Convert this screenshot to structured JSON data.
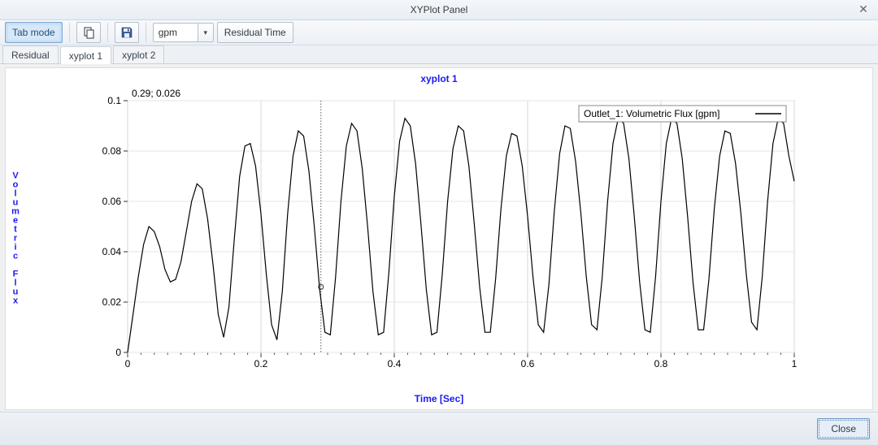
{
  "window": {
    "title": "XYPlot Panel",
    "close_glyph": "✕"
  },
  "toolbar": {
    "tab_mode": "Tab mode",
    "units_selected": "gpm",
    "residual_time": "Residual Time",
    "chevron_glyph": "▾"
  },
  "tabs": [
    {
      "label": "Residual",
      "active": false
    },
    {
      "label": "xyplot 1",
      "active": true
    },
    {
      "label": "xyplot 2",
      "active": false
    }
  ],
  "plot": {
    "title": "xyplot 1",
    "cursor_readout": "0.29; 0.026",
    "ylabel": "Volumetric Flux",
    "xlabel": "Time [Sec]",
    "legend": "Outlet_1: Volumetric Flux [gpm]"
  },
  "footer": {
    "close_label": "Close"
  },
  "chart_data": {
    "type": "line",
    "title": "xyplot 1",
    "xlabel": "Time [Sec]",
    "ylabel": "Volumetric Flux",
    "xlim": [
      0,
      1
    ],
    "ylim": [
      0,
      0.1
    ],
    "x_ticks": [
      0,
      0.2,
      0.4,
      0.6,
      0.8,
      1
    ],
    "y_ticks": [
      0,
      0.02,
      0.04,
      0.06,
      0.08,
      0.1
    ],
    "x_minor_step": 0.02,
    "cursor_x": 0.29,
    "cursor_y": 0.026,
    "legend": {
      "position": "upper-right",
      "entries": [
        "Outlet_1: Volumetric Flux [gpm]"
      ]
    },
    "series": [
      {
        "name": "Outlet_1: Volumetric Flux [gpm]",
        "x": [
          0.0,
          0.008,
          0.016,
          0.024,
          0.032,
          0.04,
          0.048,
          0.056,
          0.064,
          0.072,
          0.08,
          0.088,
          0.096,
          0.104,
          0.112,
          0.12,
          0.128,
          0.136,
          0.144,
          0.152,
          0.16,
          0.168,
          0.176,
          0.184,
          0.192,
          0.2,
          0.208,
          0.216,
          0.224,
          0.232,
          0.24,
          0.248,
          0.256,
          0.264,
          0.272,
          0.28,
          0.288,
          0.296,
          0.304,
          0.312,
          0.32,
          0.328,
          0.336,
          0.344,
          0.352,
          0.36,
          0.368,
          0.376,
          0.384,
          0.392,
          0.4,
          0.408,
          0.416,
          0.424,
          0.432,
          0.44,
          0.448,
          0.456,
          0.464,
          0.472,
          0.48,
          0.488,
          0.496,
          0.504,
          0.512,
          0.52,
          0.528,
          0.536,
          0.544,
          0.552,
          0.56,
          0.568,
          0.576,
          0.584,
          0.592,
          0.6,
          0.608,
          0.616,
          0.624,
          0.632,
          0.64,
          0.648,
          0.656,
          0.664,
          0.672,
          0.68,
          0.688,
          0.696,
          0.704,
          0.712,
          0.72,
          0.728,
          0.736,
          0.744,
          0.752,
          0.76,
          0.768,
          0.776,
          0.784,
          0.792,
          0.8,
          0.808,
          0.816,
          0.824,
          0.832,
          0.84,
          0.848,
          0.856,
          0.864,
          0.872,
          0.88,
          0.888,
          0.896,
          0.904,
          0.912,
          0.92,
          0.928,
          0.936,
          0.944,
          0.952,
          0.96,
          0.968,
          0.976,
          0.984,
          0.992,
          1.0
        ],
        "y": [
          0.0,
          0.015,
          0.03,
          0.043,
          0.05,
          0.048,
          0.042,
          0.033,
          0.028,
          0.029,
          0.036,
          0.048,
          0.06,
          0.067,
          0.065,
          0.053,
          0.035,
          0.015,
          0.006,
          0.018,
          0.045,
          0.07,
          0.082,
          0.083,
          0.074,
          0.055,
          0.031,
          0.011,
          0.005,
          0.024,
          0.055,
          0.078,
          0.088,
          0.086,
          0.072,
          0.05,
          0.025,
          0.008,
          0.007,
          0.03,
          0.06,
          0.082,
          0.091,
          0.088,
          0.073,
          0.05,
          0.024,
          0.007,
          0.008,
          0.032,
          0.062,
          0.084,
          0.093,
          0.09,
          0.075,
          0.051,
          0.025,
          0.007,
          0.008,
          0.031,
          0.06,
          0.081,
          0.09,
          0.088,
          0.074,
          0.051,
          0.026,
          0.008,
          0.008,
          0.029,
          0.057,
          0.078,
          0.087,
          0.086,
          0.074,
          0.054,
          0.03,
          0.011,
          0.008,
          0.027,
          0.056,
          0.079,
          0.09,
          0.089,
          0.076,
          0.055,
          0.03,
          0.011,
          0.009,
          0.03,
          0.06,
          0.083,
          0.093,
          0.091,
          0.077,
          0.054,
          0.028,
          0.009,
          0.008,
          0.03,
          0.06,
          0.083,
          0.093,
          0.091,
          0.077,
          0.054,
          0.028,
          0.009,
          0.009,
          0.029,
          0.057,
          0.078,
          0.088,
          0.087,
          0.075,
          0.055,
          0.031,
          0.012,
          0.009,
          0.03,
          0.06,
          0.083,
          0.093,
          0.091,
          0.078,
          0.068
        ]
      }
    ]
  }
}
